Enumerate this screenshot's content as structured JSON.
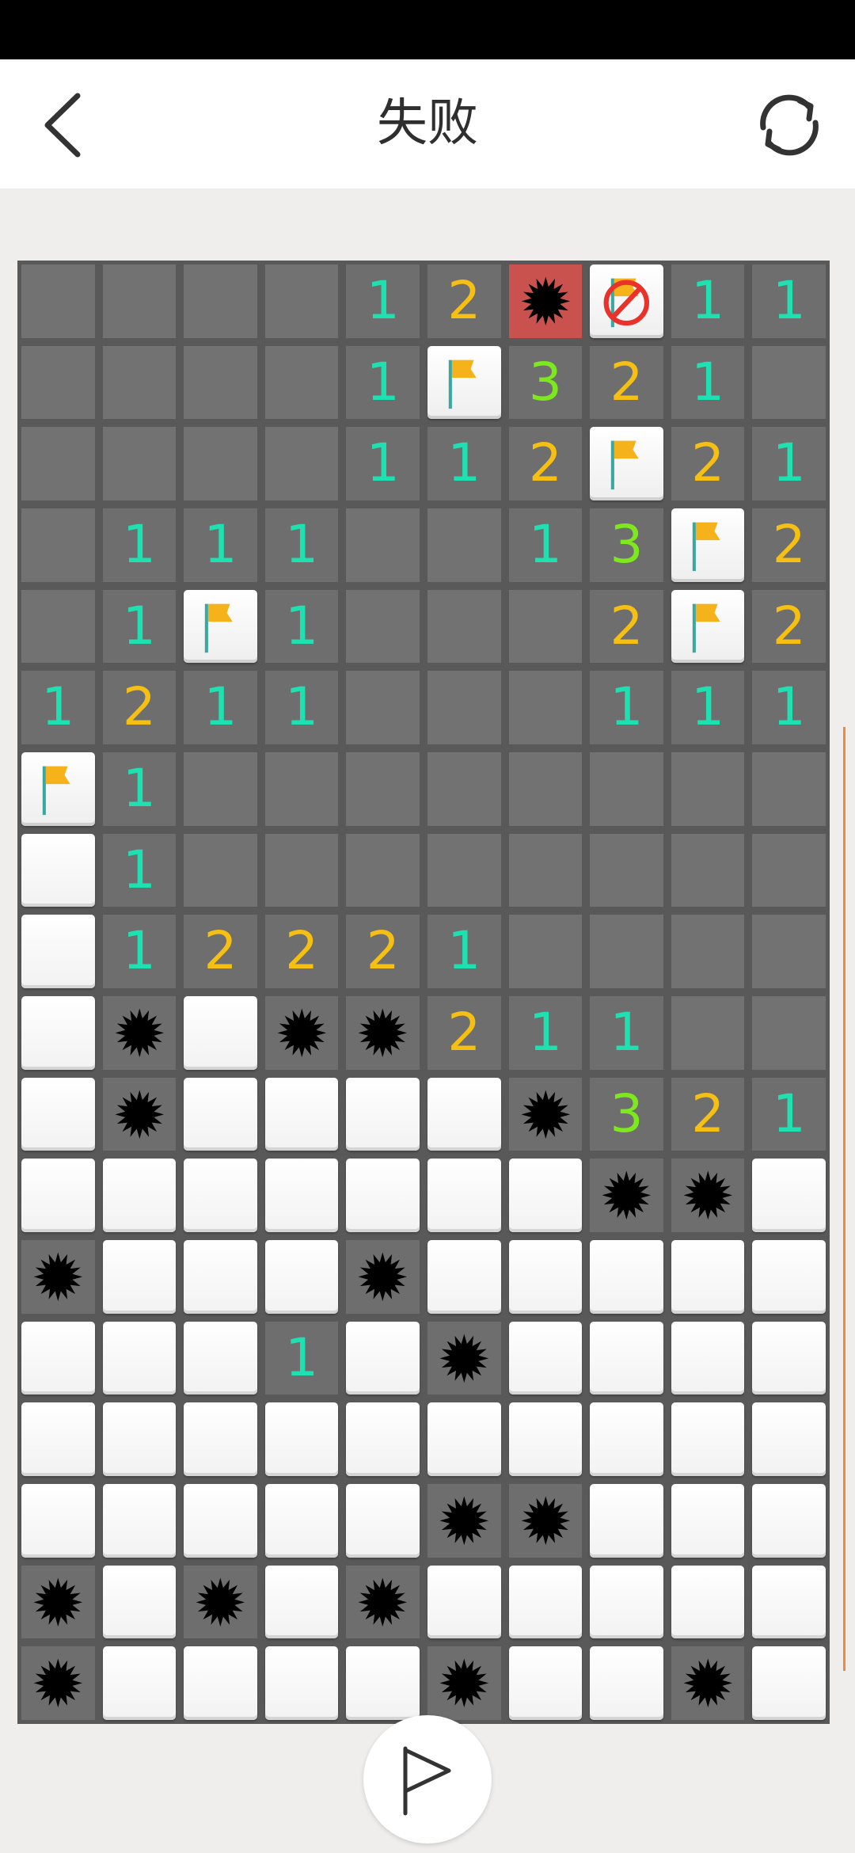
{
  "header": {
    "title": "失败",
    "back_icon": "chevron-left-icon",
    "restart_icon": "refresh-icon"
  },
  "colors": {
    "number_1": "#1fe0b0",
    "number_2": "#f5bf13",
    "number_3": "#7ee81e",
    "exploded_mine_bg": "#c9524f",
    "scroll_indicator": "#f08a3c"
  },
  "legend": {
    "H": "hidden",
    "E": "empty",
    "M": "mine",
    "B": "exploded-mine",
    "F": "flag",
    "X": "wrong-flag",
    "1-3": "number"
  },
  "board": {
    "columns": 10,
    "rows": [
      "HHHH12BX11",
      "HHHH1F321H",
      "HHHH112F21",
      "H111HH13F2",
      "H1F1HHH2F2",
      "1211HHH111",
      "F1HHHHHHHH",
      "E1HHHHHHHH",
      "E12221HHHH",
      "EMEMM211HH",
      "EMEEEEM321",
      "EEEEEEEMME",
      "MEEEMEEEEE",
      "EEE1EMEEEE",
      "EEEEEEEEEE",
      "EEEEEMMEEE",
      "MEMEMEEEEE",
      "MEEEEMEEME"
    ]
  },
  "flag_mode_button": {
    "icon": "flag-outline-icon"
  }
}
